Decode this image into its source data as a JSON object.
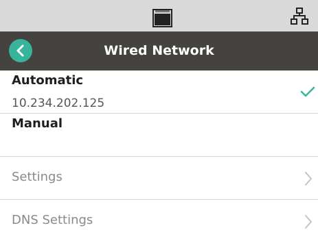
{
  "status_bar": {
    "icons": [
      "printer-icon",
      "network-icon"
    ]
  },
  "header": {
    "title": "Wired Network",
    "back_icon": "chevron-left-icon",
    "accent": "#37b49a",
    "background": "#45433f"
  },
  "options": [
    {
      "title": "Automatic",
      "value": "10.234.202.125",
      "selected": true
    },
    {
      "title": "Manual",
      "value": "",
      "selected": false
    }
  ],
  "menu": [
    {
      "label": "Settings",
      "icon": "chevron-right-icon"
    },
    {
      "label": "DNS Settings",
      "icon": "chevron-right-icon"
    }
  ],
  "colors": {
    "check": "#37b49a"
  }
}
